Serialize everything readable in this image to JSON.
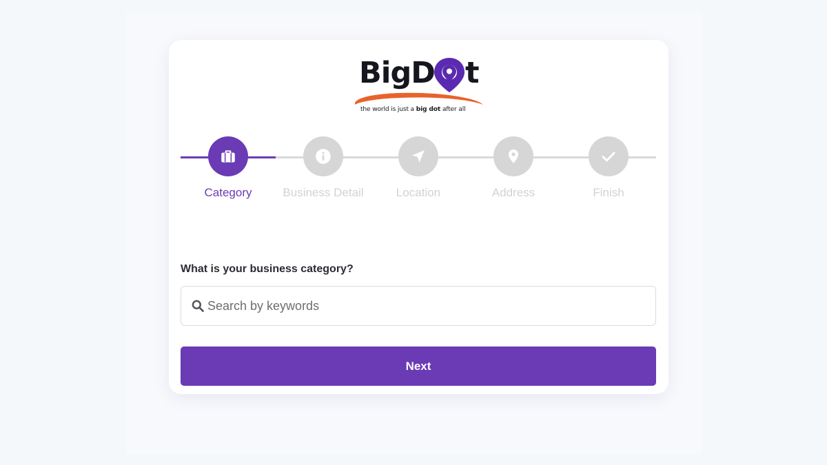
{
  "logo": {
    "word_start": "BigD",
    "word_end": "t",
    "tagline_prefix": "the world is just a ",
    "tagline_bold": "big dot",
    "tagline_suffix": " after all",
    "brand_color": "#5a2bb0",
    "swoosh_color": "#e8632c"
  },
  "stepper": {
    "active_color": "#6a3bb5",
    "inactive_color": "#d6d6d6",
    "current_step": 1,
    "steps": [
      {
        "label": "Category",
        "icon": "briefcase-icon",
        "active": true
      },
      {
        "label": "Business Detail",
        "icon": "info-icon",
        "active": false
      },
      {
        "label": "Location",
        "icon": "navigation-arrow-icon",
        "active": false
      },
      {
        "label": "Address",
        "icon": "map-pin-icon",
        "active": false
      },
      {
        "label": "Finish",
        "icon": "checkmark-icon",
        "active": false
      }
    ]
  },
  "form": {
    "question": "What is your business category?",
    "search_placeholder": "Search by keywords",
    "search_value": "",
    "next_label": "Next"
  }
}
